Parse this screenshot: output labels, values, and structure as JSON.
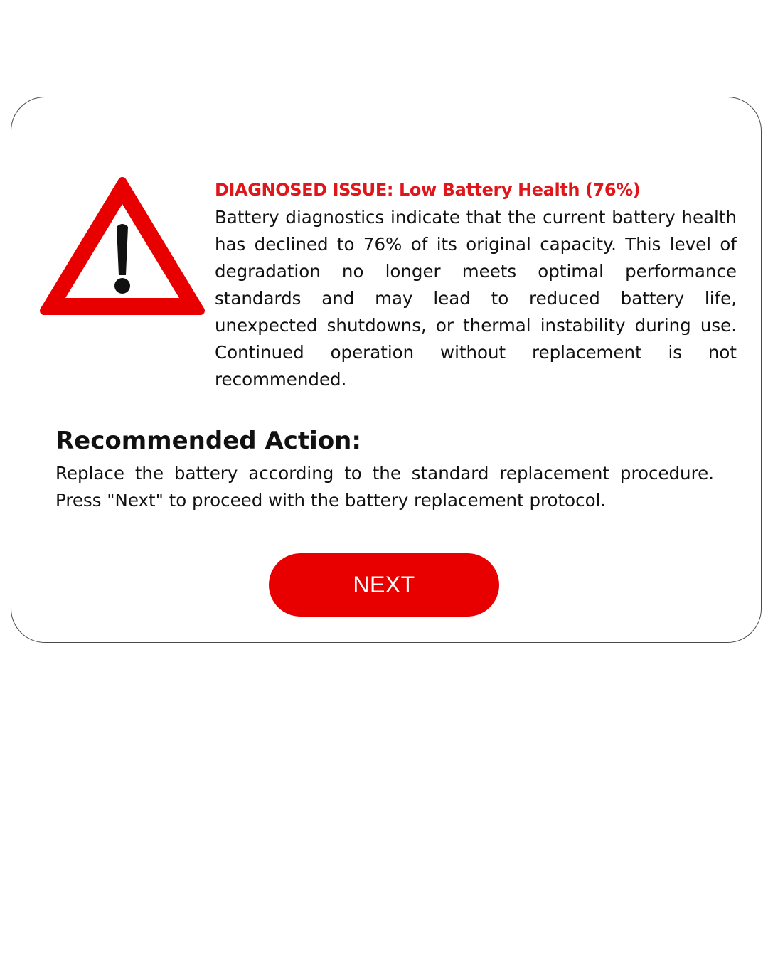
{
  "dialog": {
    "icon": "warning-triangle-icon",
    "issue_title": "DIAGNOSED ISSUE: Low Battery Health (76%)",
    "issue_body": "Battery diagnostics indicate that the current battery health has declined to 76% of its original capacity. This level of degradation no longer meets optimal performance standards and may lead to reduced battery life, unexpected shutdowns, or thermal instability during use. Continued operation without replacement is not recommended.",
    "action_title": "Recommended Action:",
    "action_body": "Replace the battery according to the standard replacement procedure. Press \"Next\" to proceed with the battery replacement protocol.",
    "next_label": "NEXT"
  },
  "colors": {
    "accent_red": "#e80000",
    "issue_title_red": "#e0161b",
    "text": "#111111",
    "background": "#ffffff"
  }
}
